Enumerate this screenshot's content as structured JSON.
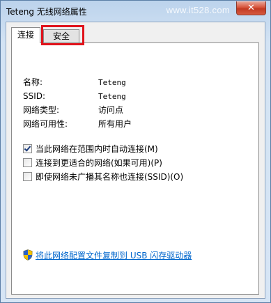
{
  "window": {
    "title": "Teteng 无线网络属性",
    "watermark": "www.it528.com",
    "close_glyph": "✕"
  },
  "tabs": [
    {
      "label": "连接",
      "active": true
    },
    {
      "label": "安全",
      "active": false
    }
  ],
  "properties": [
    {
      "label": "名称:",
      "value": "Teteng"
    },
    {
      "label": "SSID:",
      "value": "Teteng"
    },
    {
      "label": "网络类型:",
      "value": "访问点"
    },
    {
      "label": "网络可用性:",
      "value": "所有用户"
    }
  ],
  "checkboxes": [
    {
      "label": "当此网络在范围内时自动连接(M)",
      "checked": true
    },
    {
      "label": "连接到更适合的网络(如果可用)(P)",
      "checked": false
    },
    {
      "label": "即使网络未广播其名称也连接(SSID)(O)",
      "checked": false
    }
  ],
  "copy_link": {
    "text": "将此网络配置文件复制到 USB 闪存驱动器",
    "icon": "uac-shield-icon"
  },
  "colors": {
    "highlight": "#e0131b",
    "link": "#0066cc"
  }
}
